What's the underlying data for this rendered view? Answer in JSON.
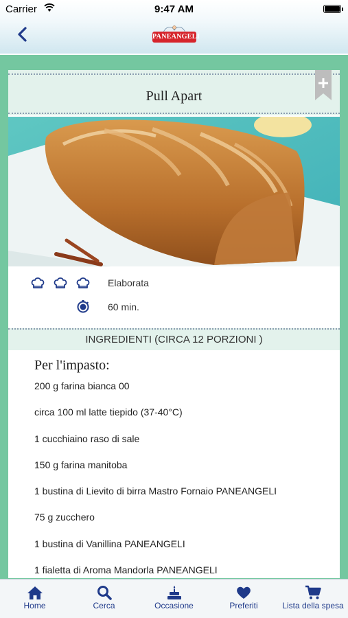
{
  "status_bar": {
    "carrier": "Carrier",
    "time": "9:47 AM"
  },
  "nav": {
    "back_icon": "chevron-left-icon",
    "logo_text": "PANEANGELI"
  },
  "recipe": {
    "title": "Pull Apart",
    "bookmark_icon": "plus-icon",
    "difficulty": "Elaborata",
    "difficulty_level": 3,
    "time": "60 min.",
    "ingredients_header": "INGREDIENTI (CIRCA 12 PORZIONI )",
    "section_title": "Per l'impasto:",
    "ingredients": [
      "200 g farina bianca 00",
      "circa 100 ml latte tiepido (37-40°C)",
      "1 cucchiaino raso di sale",
      "150 g farina manitoba",
      "1 bustina di Lievito di birra Mastro Fornaio PANEANGELI",
      "75 g zucchero",
      "1 bustina di Vanillina PANEANGELI",
      "1 fialetta di Aroma Mandorla PANEANGELI"
    ]
  },
  "tabbar": {
    "tabs": [
      {
        "label": "Home",
        "icon": "home-icon"
      },
      {
        "label": "Cerca",
        "icon": "search-icon"
      },
      {
        "label": "Occasione",
        "icon": "cake-icon"
      },
      {
        "label": "Preferiti",
        "icon": "heart-icon"
      },
      {
        "label": "Lista della spesa",
        "icon": "cart-icon"
      }
    ]
  },
  "colors": {
    "background": "#74c7a0",
    "band": "#e3f2ec",
    "accent_blue": "#1f3a8a",
    "logo_red": "#d6242b"
  }
}
